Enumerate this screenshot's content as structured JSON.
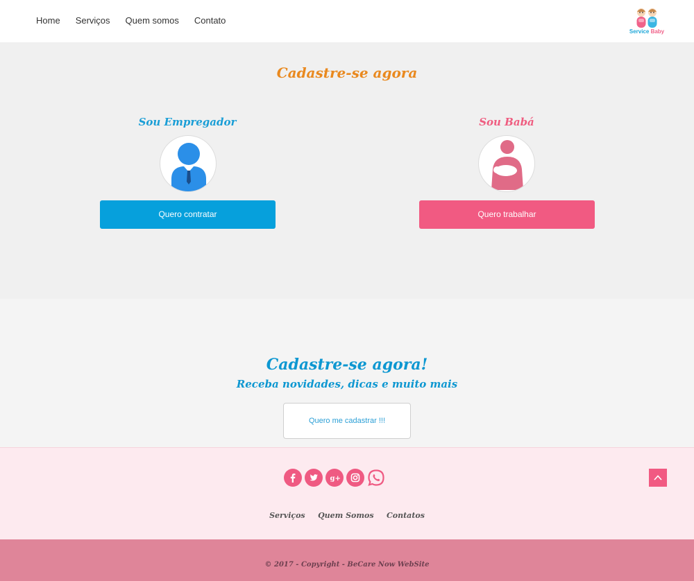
{
  "nav": {
    "items": [
      {
        "label": "Home"
      },
      {
        "label": "Serviços"
      },
      {
        "label": "Quem somos"
      },
      {
        "label": "Contato"
      }
    ]
  },
  "logo": {
    "text_part1": "Service ",
    "text_part2": "Baby"
  },
  "signup": {
    "title": "Cadastre-se agora",
    "employer": {
      "title": "Sou Empregador",
      "button": "Quero contratar"
    },
    "nanny": {
      "title": "Sou Babá",
      "button": "Quero trabalhar"
    }
  },
  "newsletter": {
    "title": "Cadastre-se agora!",
    "subtitle": "Receba novidades, dicas e muito mais",
    "button": "Quero me cadastrar !!!"
  },
  "footer": {
    "social": [
      "facebook-icon",
      "twitter-icon",
      "google-plus-icon",
      "instagram-icon",
      "whatsapp-icon"
    ],
    "links": [
      {
        "label": "Serviços"
      },
      {
        "label": "Quem Somos"
      },
      {
        "label": "Contatos"
      }
    ],
    "copyright": "© 2017 - Copyright - BeCare Now WebSite"
  },
  "colors": {
    "accent_blue": "#06a0dc",
    "accent_pink": "#f15a82",
    "title_orange": "#e9891f",
    "footer_pink": "#fdeaef",
    "bottom_bar": "#df8599"
  }
}
